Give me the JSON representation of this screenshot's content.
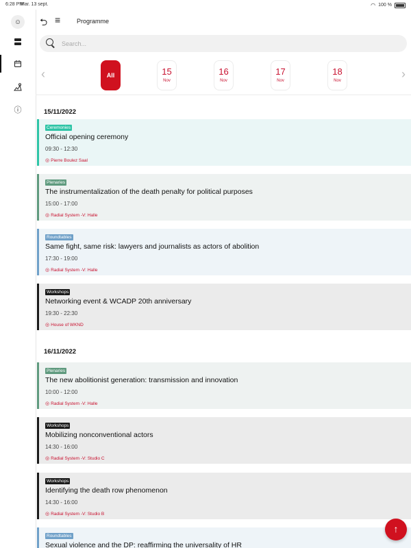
{
  "status_bar": {
    "time": "6:28 PM",
    "date": "Mar. 13 sept.",
    "battery": "100 %"
  },
  "header": {
    "title": "Programme"
  },
  "search": {
    "placeholder": "Search..."
  },
  "dates": [
    {
      "label": "All",
      "month": ""
    },
    {
      "label": "15",
      "month": "Nov"
    },
    {
      "label": "16",
      "month": "Nov"
    },
    {
      "label": "17",
      "month": "Nov"
    },
    {
      "label": "18",
      "month": "Nov"
    }
  ],
  "days": [
    {
      "date": "15/11/2022",
      "events": [
        {
          "tag": "Ceremonies",
          "title": "Official opening ceremony",
          "time": "09:30 - 12:30",
          "location": "Pierre Boulez Saal"
        },
        {
          "tag": "Plenaries",
          "title": "The instrumentalization of the death penalty for political  purposes",
          "time": "15:00 - 17:00",
          "location": "Radial System -V: Halle"
        },
        {
          "tag": "Roundtables",
          "title": "Same fight, same risk:  lawyers and journalists as  actors of abolition",
          "time": "17:30 - 19:00",
          "location": "Radial System -V: Halle"
        },
        {
          "tag": "Workshops",
          "title": "Networking event & WCADP  20th anniversary",
          "time": "19:30 - 22:30",
          "location": "House of WKND"
        }
      ]
    },
    {
      "date": "16/11/2022",
      "events": [
        {
          "tag": "Plenaries",
          "title": "The new abolitionist generation: transmission and  innovation",
          "time": "10:00 - 12:00",
          "location": "Radial System -V: Halle"
        },
        {
          "tag": "Workshops",
          "title": "Mobilizing nonconventional  actors",
          "time": "14:30 - 16:00",
          "location": "Radial System -V: Studio C"
        },
        {
          "tag": "Workshops",
          "title": "Identifying the  death row  phenomenon",
          "time": "14:30 - 16:00",
          "location": "Radial System -V: Studio B"
        },
        {
          "tag": "Roundtables",
          "title": "Sexual violence  and the DP: reaffirming the  universality of HR",
          "time": "",
          "location": ""
        }
      ]
    }
  ],
  "colors": {
    "accent": "#d0111f",
    "ceremonies": "#2ec4a6",
    "plenaries": "#5f9a7e",
    "roundtables": "#6fa0c8",
    "workshops": "#1a1a1a"
  }
}
